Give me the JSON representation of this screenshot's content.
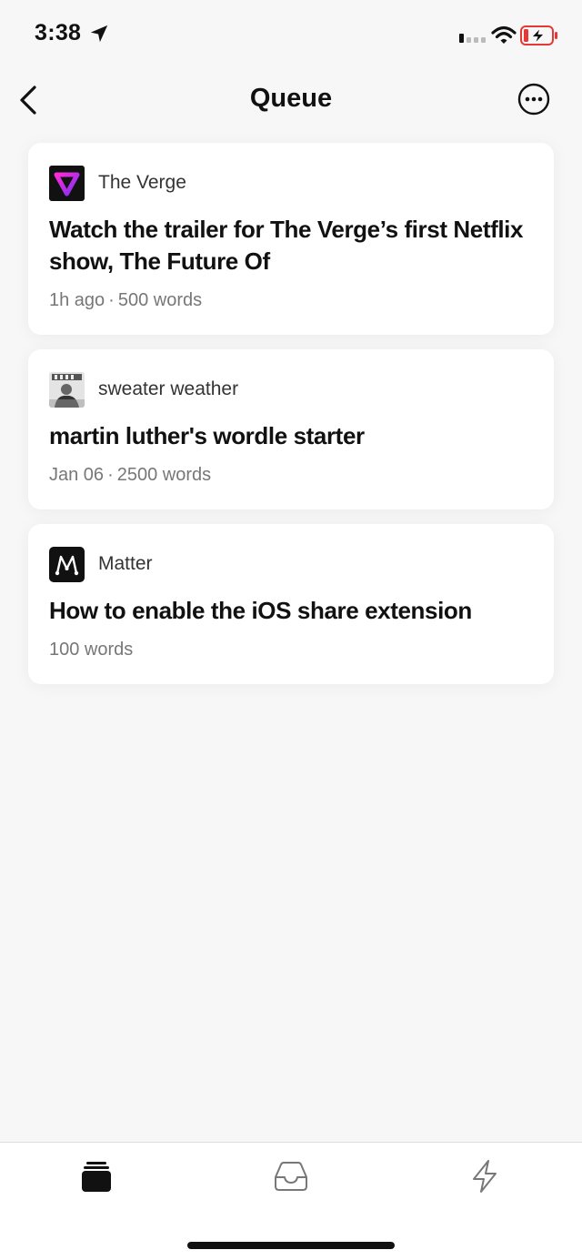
{
  "status_bar": {
    "time": "3:38",
    "icons": [
      "location-arrow-icon",
      "cellular-signal-icon",
      "wifi-icon",
      "battery-charging-icon"
    ]
  },
  "nav": {
    "title": "Queue",
    "back_icon": "chevron-left-icon",
    "more_icon": "ellipsis-circle-icon"
  },
  "cards": [
    {
      "source": "The Verge",
      "logo": "the-verge-logo",
      "title": "Watch the trailer for The Verge’s first Netflix show, The Future Of",
      "time": "1h ago",
      "words": "500 words"
    },
    {
      "source": "sweater weather",
      "logo": "sweater-weather-avatar",
      "title": "martin luther's wordle starter",
      "time": "Jan 06",
      "words": "2500 words"
    },
    {
      "source": "Matter",
      "logo": "matter-logo",
      "title": "How to enable the iOS share extension",
      "words": "100 words"
    }
  ],
  "meta_separator": "·",
  "tabs": [
    {
      "icon": "stack-icon",
      "active": true
    },
    {
      "icon": "inbox-tray-icon",
      "active": false
    },
    {
      "icon": "lightning-bolt-icon",
      "active": false
    }
  ],
  "colors": {
    "background": "#f7f7f7",
    "card": "#ffffff",
    "meta_text": "#777777",
    "battery_low": "#e53935"
  }
}
